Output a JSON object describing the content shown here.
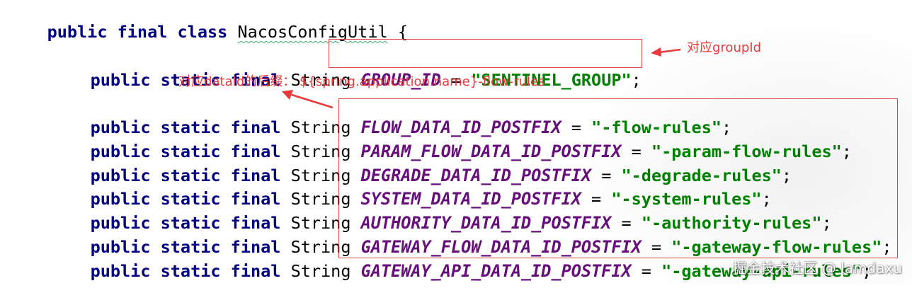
{
  "editor": {
    "class_line": {
      "keywords": "public final class",
      "class_name": "NacosConfigUtil",
      "brace": "{"
    },
    "modifiers": "public static final",
    "type": "String",
    "fields": [
      {
        "name": "GROUP_ID",
        "value": "\"SENTINEL_GROUP\""
      },
      {
        "name": "FLOW_DATA_ID_POSTFIX",
        "value": "\"-flow-rules\""
      },
      {
        "name": "PARAM_FLOW_DATA_ID_POSTFIX",
        "value": "\"-param-flow-rules\""
      },
      {
        "name": "DEGRADE_DATA_ID_POSTFIX",
        "value": "\"-degrade-rules\""
      },
      {
        "name": "SYSTEM_DATA_ID_POSTFIX",
        "value": "\"-system-rules\""
      },
      {
        "name": "AUTHORITY_DATA_ID_POSTFIX",
        "value": "\"-authority-rules\""
      },
      {
        "name": "GATEWAY_FLOW_DATA_ID_POSTFIX",
        "value": "\"-gateway-flow-rules\""
      },
      {
        "name": "GATEWAY_API_DATA_ID_POSTFIX",
        "value": "\"-gateway-api-rules\""
      }
    ],
    "equals": "=",
    "semicolon": ";"
  },
  "annotations": {
    "group_id_note": "对应groupId",
    "data_id_note": "对应dataId的后缀： ${spring.application.name}-flow-rules",
    "color": "#e83a3a"
  },
  "watermark": "掘金技术社区 @ lamdaxu"
}
